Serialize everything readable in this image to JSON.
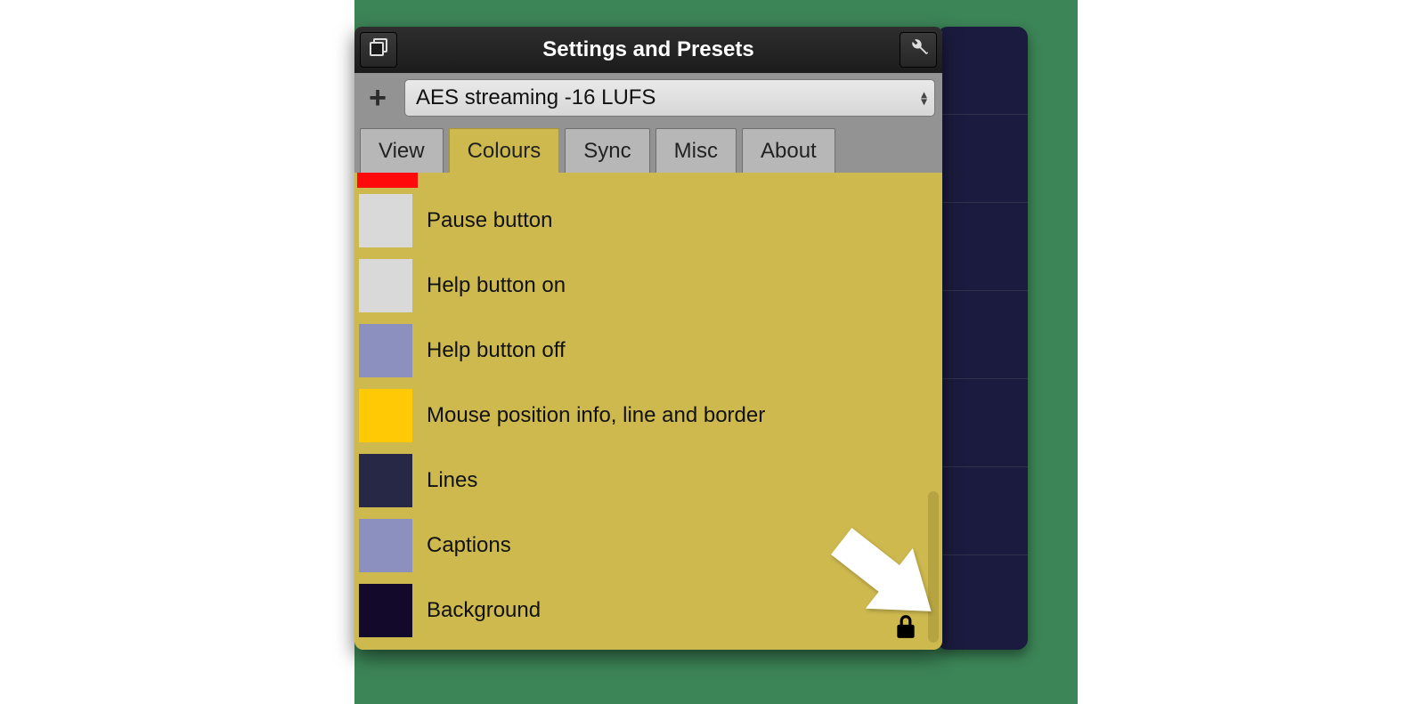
{
  "window": {
    "title": "Settings and Presets"
  },
  "preset": {
    "add_icon": "plus-icon",
    "selected": "AES streaming -16 LUFS"
  },
  "tabs": {
    "items": [
      {
        "label": "View",
        "active": false
      },
      {
        "label": "Colours",
        "active": true
      },
      {
        "label": "Sync",
        "active": false
      },
      {
        "label": "Misc",
        "active": false
      },
      {
        "label": "About",
        "active": false
      }
    ]
  },
  "colours": {
    "first_strip_color": "#ff0a0a",
    "items": [
      {
        "label": "Pause button",
        "swatch": "#d9d9d9"
      },
      {
        "label": "Help button on",
        "swatch": "#d9d9d9"
      },
      {
        "label": "Help button off",
        "swatch": "#8b90bf"
      },
      {
        "label": "Mouse position info, line and border",
        "swatch": "#ffc905"
      },
      {
        "label": "Lines",
        "swatch": "#272846"
      },
      {
        "label": "Captions",
        "swatch": "#8b90bf"
      },
      {
        "label": "Background",
        "swatch": "#12092b"
      }
    ]
  },
  "right_panel": {
    "row_count": 7
  }
}
